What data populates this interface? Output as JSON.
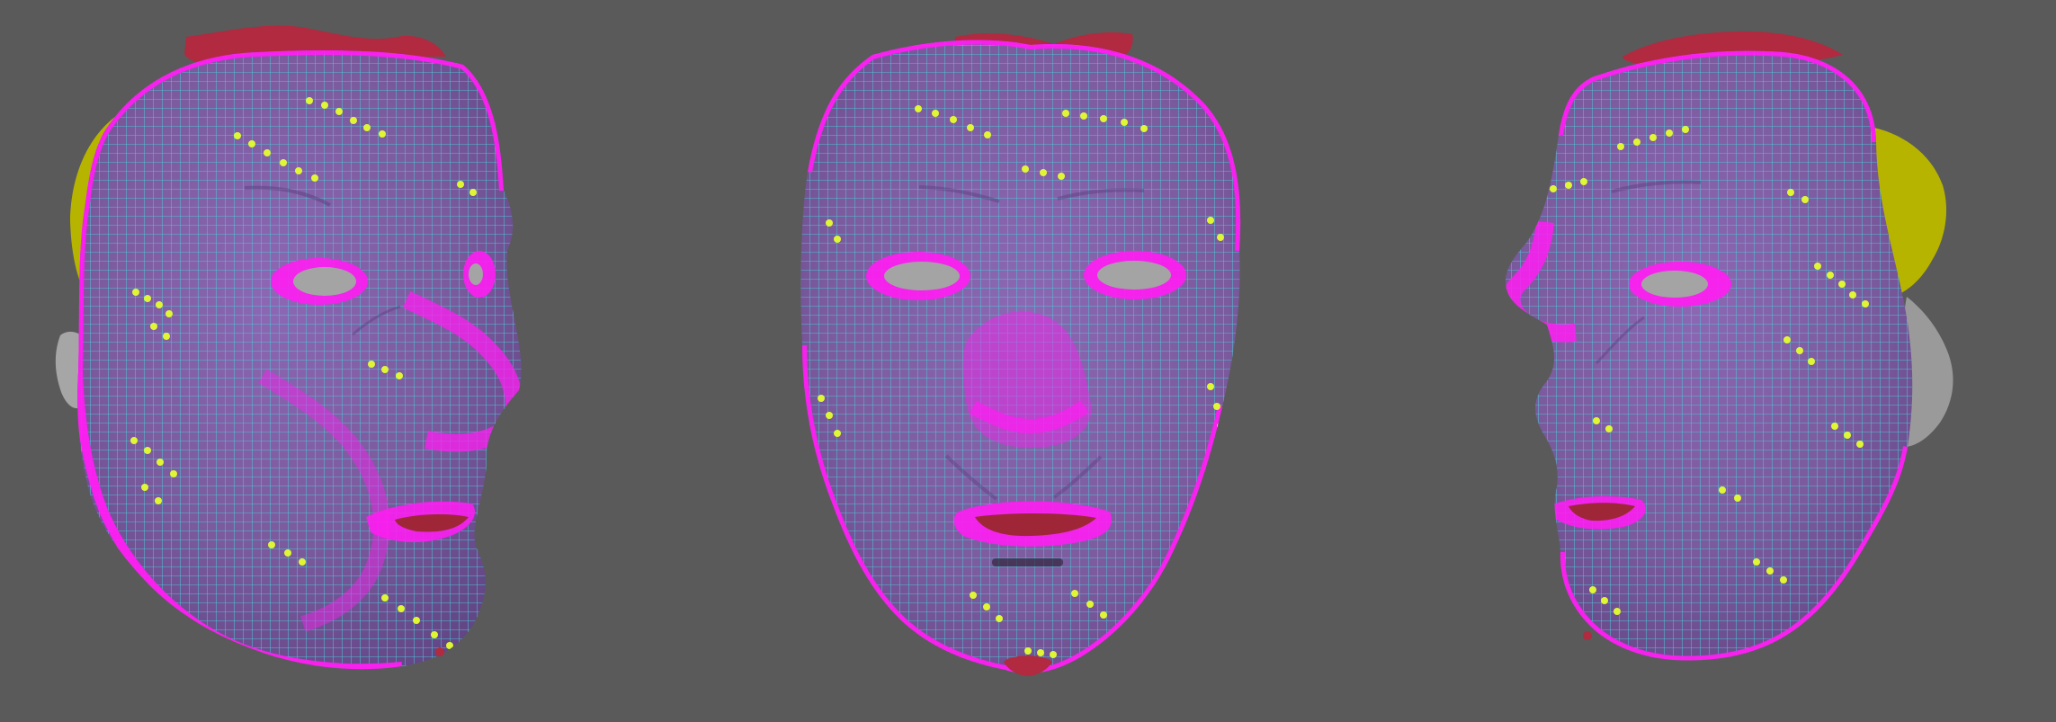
{
  "scene": {
    "background_color": "#5a5a5a",
    "views": [
      {
        "name": "left-three-quarter-view",
        "facing": "right"
      },
      {
        "name": "front-view",
        "facing": "front"
      },
      {
        "name": "right-three-quarter-view",
        "facing": "left"
      }
    ],
    "colors": {
      "skin_base": "#7b5a9d",
      "skin_shadow": "#5f4484",
      "wire_cyan": "#49c8d7",
      "wire_magenta": "#ff1df2",
      "marker_yellow": "#e6ff2f",
      "hair_red": "#b12a3f",
      "ear_yellow": "#b7b400",
      "eye_gray": "#a4a4a4",
      "mouth_red": "#9e2637",
      "neck_gray": "#9a9a9a"
    }
  }
}
